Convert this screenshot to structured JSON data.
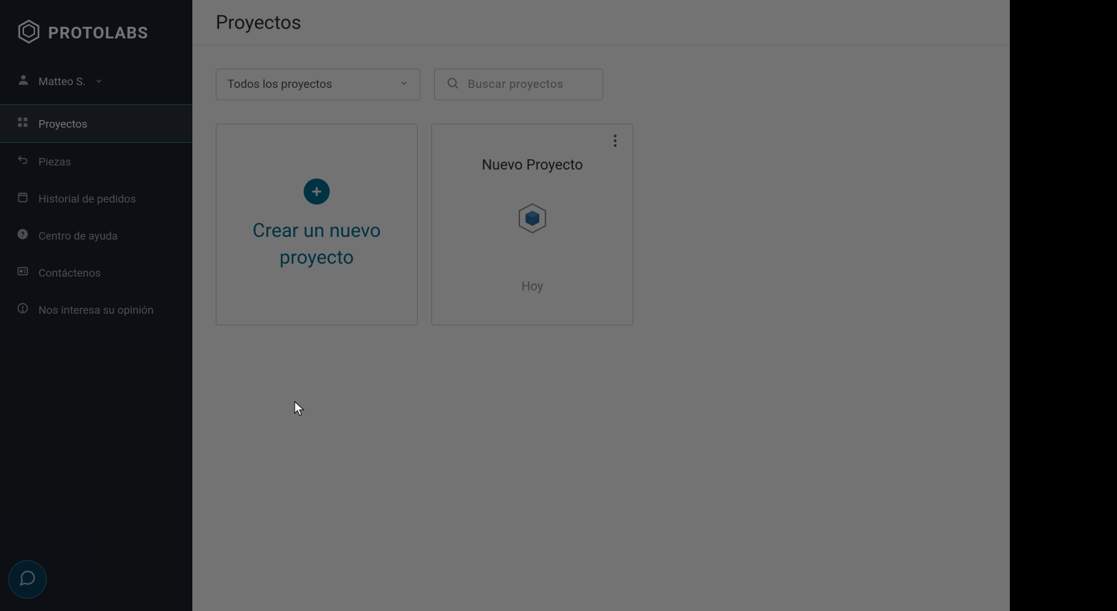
{
  "brand": {
    "name": "PROTOLABS"
  },
  "user": {
    "display_name": "Matteo S."
  },
  "sidebar": {
    "items": [
      {
        "label": "Proyectos",
        "icon": "grid-icon",
        "active": true
      },
      {
        "label": "Piezas",
        "icon": "undo-icon",
        "active": false
      },
      {
        "label": "Historial de pedidos",
        "icon": "history-icon",
        "active": false
      },
      {
        "label": "Centro de ayuda",
        "icon": "help-icon",
        "active": false
      },
      {
        "label": "Contáctenos",
        "icon": "contact-icon",
        "active": false
      },
      {
        "label": "Nos interesa su opinión",
        "icon": "feedback-icon",
        "active": false
      }
    ]
  },
  "header": {
    "title": "Proyectos"
  },
  "filter": {
    "selected": "Todos los proyectos"
  },
  "search": {
    "placeholder": "Buscar proyectos"
  },
  "create_card": {
    "label": "Crear un nuevo proyecto"
  },
  "projects": [
    {
      "title": "Nuevo Proyecto",
      "date": "Hoy"
    }
  ],
  "colors": {
    "sidebar_bg": "#1c222b",
    "accent": "#006f94",
    "text_muted": "#8d949c"
  }
}
